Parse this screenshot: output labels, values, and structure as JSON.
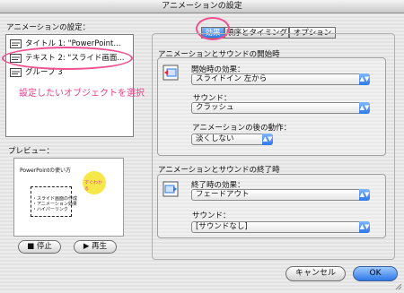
{
  "window": {
    "title": "アニメーションの設定"
  },
  "left": {
    "list_label": "アニメーションの設定：",
    "items": [
      {
        "label": "タイトル 1: \"PowerPoint..."
      },
      {
        "label": "テキスト 2: \"スライド画面..."
      },
      {
        "label": "グループ 3"
      }
    ],
    "callout": "設定したいオブジェクトを選択",
    "preview_label": "プレビュー：",
    "preview": {
      "slide_title": "PowerPointの使い方",
      "bullets": [
        "スライド画面の作成",
        "アニメーション効果",
        "ハイパーリンク"
      ],
      "sticker": "すぐわかる"
    },
    "stop_label": "停止",
    "play_label": "再生"
  },
  "tabs": [
    {
      "label": "効果"
    },
    {
      "label": "順序とタイミング"
    },
    {
      "label": "オプション"
    }
  ],
  "start_group": {
    "title": "アニメーションとサウンドの開始時",
    "effect_label": "開始時の効果：",
    "effect_value": "スライドイン 左から",
    "sound_label": "サウンド：",
    "sound_value": "クラッシュ",
    "after_label": "アニメーションの後の動作：",
    "after_value": "淡くしない"
  },
  "end_group": {
    "title": "アニメーションとサウンドの終了時",
    "effect_label": "終了時の効果：",
    "effect_value": "フェードアウト",
    "sound_label": "サウンド：",
    "sound_value": "[サウンドなし]"
  },
  "buttons": {
    "cancel": "キャンセル",
    "ok": "OK"
  },
  "colors": {
    "highlight": "#f0508f",
    "selection": "#1c5fd4",
    "aqua": "#2f78e6"
  }
}
